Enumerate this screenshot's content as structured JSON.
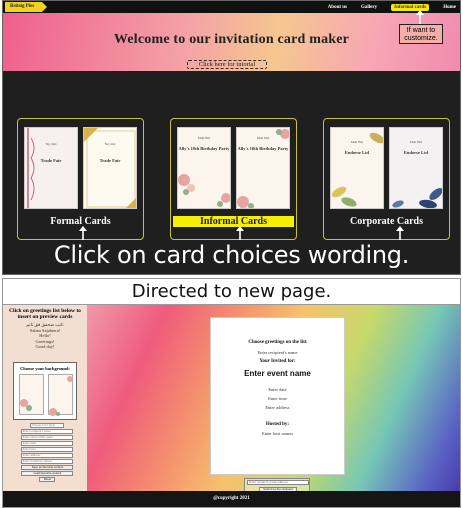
{
  "site": {
    "logo": "Rsitsig Pies",
    "nav": [
      "About us",
      "Gallery",
      "Informal cards",
      "Home"
    ],
    "hero_title": "Welcome to our invitation card maker",
    "tutorial_link": "Click here for tutorial"
  },
  "annotation_note": "If want to customize.",
  "categories": [
    {
      "label": "Formal Cards",
      "cards": [
        {
          "top": "Ng rmd",
          "main": "Trade Fair"
        },
        {
          "top": "Ng rmd",
          "main": "Trade Fair"
        }
      ]
    },
    {
      "label": "Informal Cards",
      "cards": [
        {
          "top": "Mail Bid",
          "main": "Ally's 10th Birthday Party"
        },
        {
          "top": "Mail Bid",
          "main": "Ally's 10th Birthday Party"
        }
      ]
    },
    {
      "label": "Corporate Cards",
      "cards": [
        {
          "top": "Mail Bid",
          "main": "Endorse Ltd"
        },
        {
          "top": "Mail Bid",
          "main": "Endorse Ltd"
        }
      ]
    }
  ],
  "caption_top": "Click on card choices wording.",
  "caption_bottom": "Directed to new page.",
  "editor": {
    "sidebar_title": "Click on greetings list below to insert on preview cards",
    "greetings": [
      "ناتب صحفق فق تاتم",
      "Salam Sejahtera!",
      "Hello!",
      "Greetings!",
      "Good day!"
    ],
    "background_title": "Choose your background:",
    "controls": [
      "Choose Font Style",
      "Enter recipient's name",
      "Enter name of the event",
      "Enter date",
      "Enter time",
      "Enter address",
      "Enter hosted by names",
      "Save as favourite content",
      "Load favourite content",
      "Reset"
    ],
    "preview": {
      "greeting": "Choose greetings on the list",
      "recipient": "Enter recipient's name",
      "invited": "Your Invited for:",
      "event": "Enter event name",
      "date": "Enter date",
      "time": "Enter time",
      "address": "Enter address",
      "hosted_by": "Hosted by:",
      "host": "Enter host names"
    },
    "email_placeholder": "Enter recipient gmail address",
    "submit": "Submit to the recipient",
    "copyright": "@copyright 2021"
  }
}
